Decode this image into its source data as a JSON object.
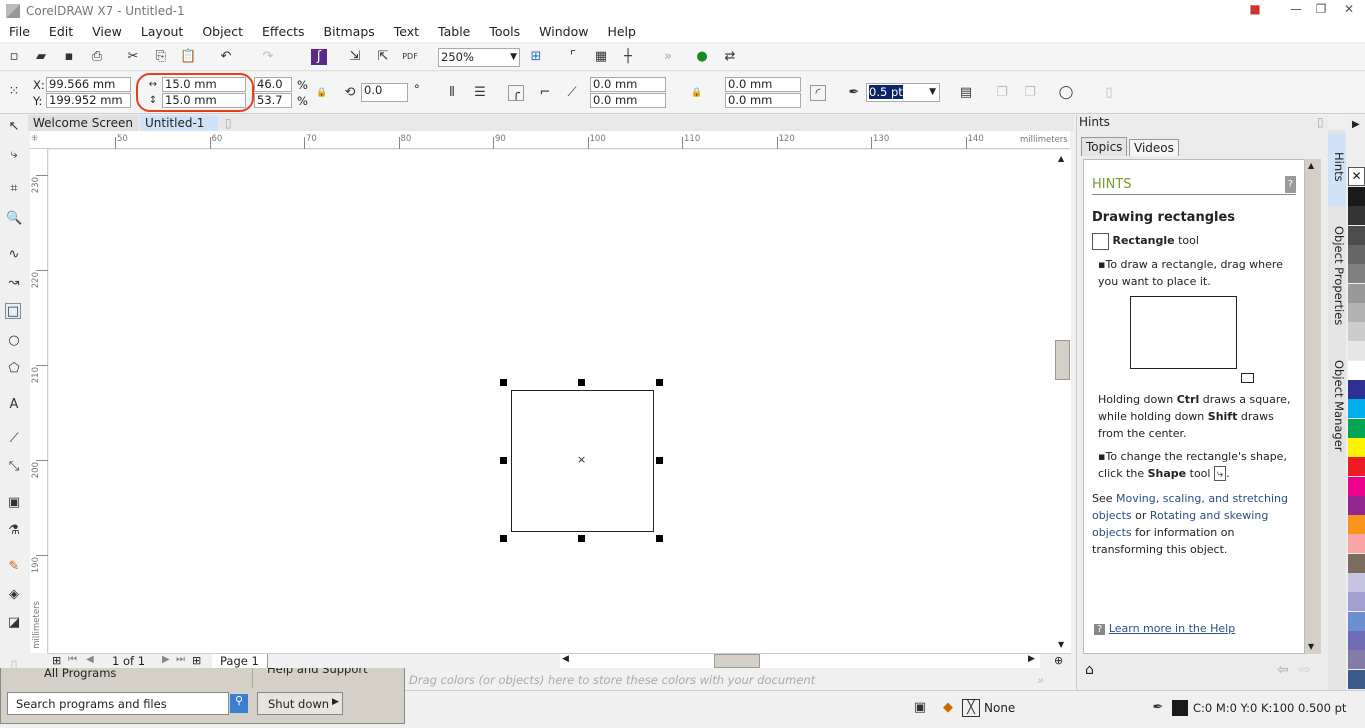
{
  "window": {
    "title": "CorelDRAW X7 - Untitled-1"
  },
  "menu": [
    "File",
    "Edit",
    "View",
    "Layout",
    "Object",
    "Effects",
    "Bitmaps",
    "Text",
    "Table",
    "Tools",
    "Window",
    "Help"
  ],
  "toolbar": {
    "zoom_level": "250%"
  },
  "propbar": {
    "x_label": "X:",
    "x_value": "99.566 mm",
    "y_label": "Y:",
    "y_value": "199.952 mm",
    "width_value": "15.0 mm",
    "height_value": "15.0 mm",
    "scale_x": "46.0",
    "scale_y": "53.7",
    "pct": "%",
    "rotation": "0.0",
    "degree": "°",
    "corner_tl": "0.0 mm",
    "corner_bl": "0.0 mm",
    "corner_tr": "0.0 mm",
    "corner_br": "0.0 mm",
    "outline_width": "0.5 pt",
    "highlight_color": "#e8401c"
  },
  "doc_tabs": [
    "Welcome Screen",
    "Untitled-1"
  ],
  "rulers": {
    "h_ticks": [
      "50",
      "60",
      "70",
      "80",
      "90",
      "100",
      "110",
      "120",
      "130",
      "140"
    ],
    "h_unit": "millimeters",
    "v_ticks": [
      "230",
      "220",
      "210",
      "200",
      "190"
    ],
    "v_unit": "millimeters"
  },
  "page_nav": {
    "count": "1 of 1",
    "page_tab": "Page 1"
  },
  "palette_hint": "Drag colors (or objects) here to store these colors with your document",
  "docker": {
    "title": "Hints",
    "tabs": [
      "Topics",
      "Videos"
    ],
    "heading": "HINTS",
    "subheading": "Drawing rectangles",
    "tool_name": "Rectangle",
    "tool_suffix": " tool",
    "bullet1": "To draw a rectangle, drag where you want to place it.",
    "p_ctrl_1": "Holding down ",
    "p_ctrl_b1": "Ctrl",
    "p_ctrl_2": " draws a square, while holding down ",
    "p_ctrl_b2": "Shift",
    "p_ctrl_3": " draws from the center.",
    "bullet2_a": "To change the rectangle's shape, click the ",
    "bullet2_b": "Shape",
    "bullet2_c": " tool",
    "see": "See ",
    "link1": "Moving, scaling, and stretching objects",
    "or": " or ",
    "link2": "Rotating and skewing objects",
    "see_end": " for information on transforming this object.",
    "learn_more": "Learn more in the Help"
  },
  "side_tabs": [
    "Hints",
    "Object Properties",
    "Object Manager"
  ],
  "palette": [
    "#1a1a1a",
    "#333333",
    "#4d4d4d",
    "#666666",
    "#808080",
    "#999999",
    "#b3b3b3",
    "#cccccc",
    "#e6e6e6",
    "#ffffff",
    "#2e3192",
    "#00aeef",
    "#00a651",
    "#fff200",
    "#ed1c24",
    "#ec008c",
    "#92278f",
    "#f7941d",
    "#f9a3a3",
    "#7d6b5d",
    "#c6c3e0",
    "#a39fd0",
    "#6b8fd0",
    "#6f6bb5",
    "#857ba8",
    "#3c5a8a"
  ],
  "start_menu": {
    "all_programs": "All Programs",
    "help": "Help and Support",
    "search_placeholder": "Search programs and files",
    "shutdown": "Shut down"
  },
  "status": {
    "fill": "None",
    "outline": "C:0 M:0 Y:0 K:100  0.500 pt"
  }
}
